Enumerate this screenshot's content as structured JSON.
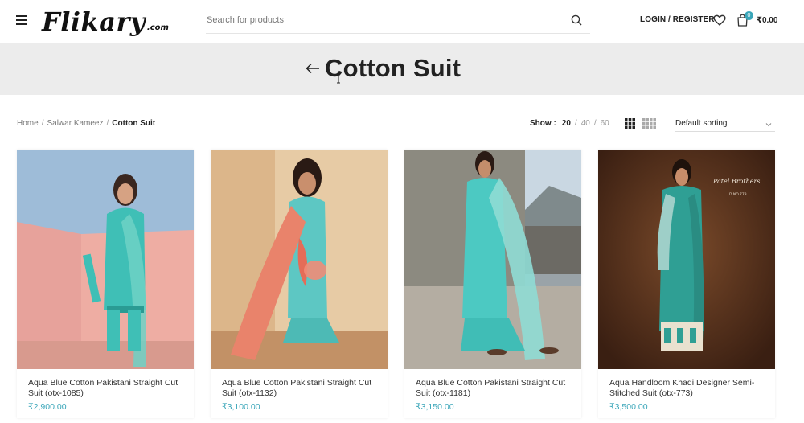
{
  "header": {
    "logo_text": "Flikary",
    "logo_suffix": ".com",
    "search_placeholder": "Search for products",
    "login_label": "LOGIN / REGISTER",
    "cart_count": "0",
    "cart_total": "₹0.00"
  },
  "title_band": {
    "title": "Cotton Suit"
  },
  "breadcrumb": {
    "items": [
      "Home",
      "Salwar Kameez"
    ],
    "current": "Cotton Suit"
  },
  "toolbar": {
    "show_label": "Show :",
    "show_options": [
      "20",
      "40",
      "60"
    ],
    "sort_label": "Default sorting"
  },
  "products": [
    {
      "name": "Aqua Blue Cotton Pakistani Straight Cut Suit (otx-1085)",
      "price": "₹2,900.00"
    },
    {
      "name": "Aqua Blue Cotton Pakistani Straight Cut Suit (otx-1132)",
      "price": "₹3,100.00"
    },
    {
      "name": "Aqua Blue Cotton Pakistani Straight Cut Suit (otx-1181)",
      "price": "₹3,150.00"
    },
    {
      "name": "Aqua Handloom Khadi Designer Semi-Stitched Suit (otx-773)",
      "price": "₹3,500.00",
      "image_caption": "Patel Brothers",
      "image_subcaption": "D.NO.773"
    }
  ],
  "colors": {
    "accent": "#3aa6b9",
    "title_band": "#ececec",
    "suit": "#3fbfb6"
  }
}
